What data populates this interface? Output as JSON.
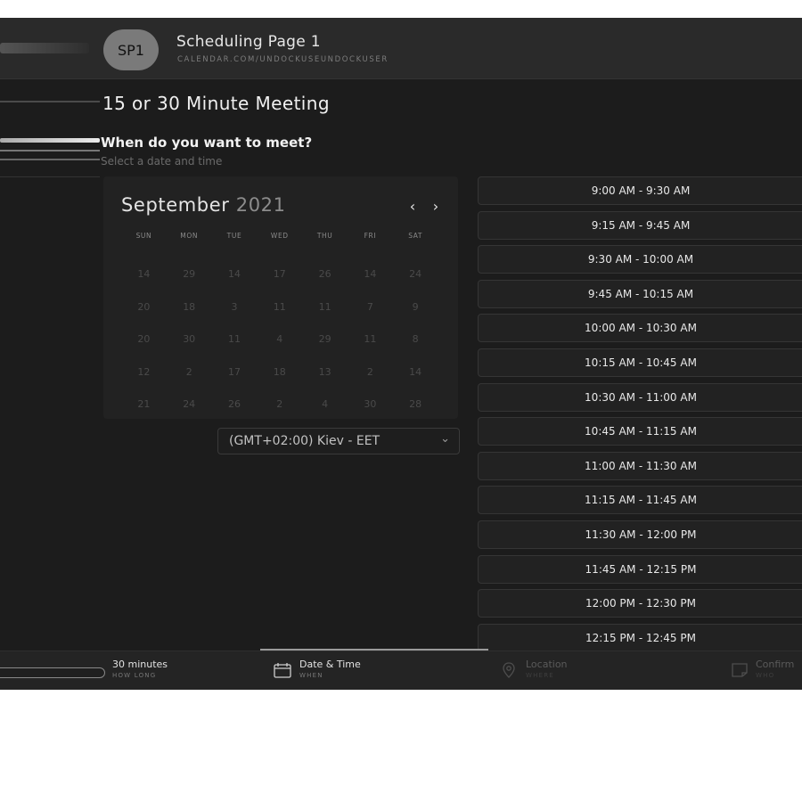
{
  "header": {
    "avatar_initials": "SP1",
    "title": "Scheduling Page 1",
    "url": "CALENDAR.COM/UNDOCKUSEUNDOCKUSER"
  },
  "page": {
    "title": "15 or 30 Minute Meeting",
    "question": "When do you want to meet?",
    "subtitle": "Select a date and time"
  },
  "calendar": {
    "month": "September",
    "year": "2021",
    "prev_icon": "chevron-left-icon",
    "next_icon": "chevron-right-icon",
    "days_of_week": [
      "SUN",
      "MON",
      "TUE",
      "WED",
      "THU",
      "FRI",
      "SAT"
    ],
    "weeks": [
      [
        "14",
        "29",
        "14",
        "17",
        "26",
        "14",
        "24"
      ],
      [
        "20",
        "18",
        "3",
        "11",
        "11",
        "7",
        "9"
      ],
      [
        "20",
        "30",
        "11",
        "4",
        "29",
        "11",
        "8"
      ],
      [
        "12",
        "2",
        "17",
        "18",
        "13",
        "2",
        "14"
      ],
      [
        "21",
        "24",
        "26",
        "2",
        "4",
        "30",
        "28"
      ]
    ]
  },
  "timezone": {
    "value": "(GMT+02:00) Kiev - EET",
    "icon": "chevron-down-icon"
  },
  "time_slots": [
    "9:00 AM - 9:30 AM",
    "9:15 AM - 9:45 AM",
    "9:30 AM - 10:00 AM",
    "9:45 AM - 10:15 AM",
    "10:00 AM - 10:30 AM",
    "10:15 AM - 10:45 AM",
    "10:30 AM - 11:00 AM",
    "10:45 AM - 11:15 AM",
    "11:00 AM - 11:30 AM",
    "11:15 AM - 11:45 AM",
    "11:30 AM - 12:00 PM",
    "11:45 AM - 12:15 PM",
    "12:00 PM - 12:30 PM",
    "12:15 PM - 12:45 PM"
  ],
  "steps": [
    {
      "label": "30 minutes",
      "sub": "HOW LONG",
      "icon": ""
    },
    {
      "label": "Date & Time",
      "sub": "WHEN",
      "icon": "calendar-icon"
    },
    {
      "label": "Location",
      "sub": "WHERE",
      "icon": "location-pin-icon"
    },
    {
      "label": "Confirm",
      "sub": "WHO",
      "icon": "note-icon"
    }
  ]
}
